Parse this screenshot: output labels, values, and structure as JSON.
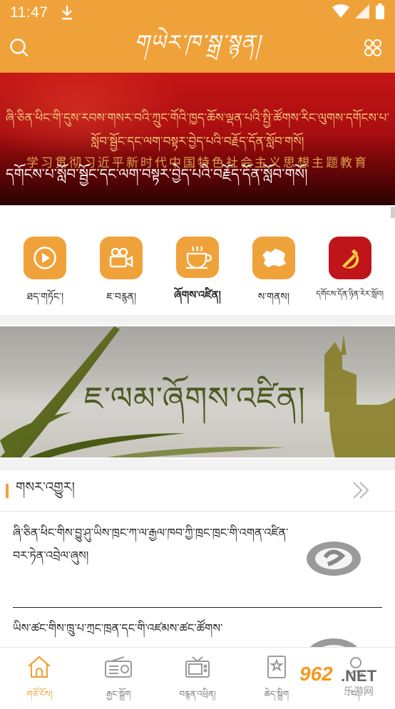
{
  "status_bar": {
    "time": "11:47"
  },
  "header": {
    "title": "གཡེར་ཁ་སྒྲ་སྙན།"
  },
  "banner": {
    "line1": "ཞི་ཅིན་ཕིང་གི་དུས་རབས་གསར་བའི་ཀྲུང་གོའི་ཁྱད་ཆོས་ལྡན་པའི་སྤྱི་ཚོགས་རིང་ལུགས་དགོངས་པ་",
    "line2": "སློབ་སྦྱོང་དང་ལག་བསྟར་བྱེད་པའི་བརྗོད་དོན་སློབ་གསོ།",
    "line3": "学习贯彻习近平新时代中国特色社会主义思想主题教育",
    "caption": "དགོངས་པ་སློབ་སྦྱོང་དང་ལག་བསྟར་བྱེད་པའི་བརྗོད་དོན་སློབ་གསོ།"
  },
  "categories": [
    {
      "label": "ཐད་གཏོང་།",
      "icon": "play-icon"
    },
    {
      "label": "ཇ་བརྙན།",
      "icon": "video-camera-icon"
    },
    {
      "label": "ཞོགས་འཛིན།",
      "icon": "tea-cup-icon"
    },
    {
      "label": "ས་གནས།",
      "icon": "map-icon"
    },
    {
      "label": "དགོངས་དོན་ཉིན་རེར་སློབ།",
      "icon": "party-emblem-icon"
    }
  ],
  "promo": {
    "title": "ཇ་ལམ་ཞོགས་འཛིན།"
  },
  "section": {
    "title": "གསར་འགྱུར།"
  },
  "news": [
    {
      "title": "ཞི་ཅིན་ཕིང་གིས་བྱུ་ཤུ་ཡིས་ཁྲང་ཀ་ལ་རྒྱལ་ཁབ་ཀྱི་ཁྲང་ཁྲང་གི་འགན་འཛིན་བར་ཏེན་འབྲེལ་ཞུས།"
    },
    {
      "title": "ཡིས་ཚང་གིས་ཁྲུ་པ་ཀྲང་ཁྲན་དང་གི་འཛམས་ཚང་ཚོགས་"
    }
  ],
  "tabs": [
    {
      "label": "གཙོ་ངོས།",
      "icon": "home-icon",
      "active": true
    },
    {
      "label": "རྒྱང་སྒྲོག",
      "icon": "radio-icon",
      "active": false
    },
    {
      "label": "བརྙན་འཕྲིན།",
      "icon": "tv-icon",
      "active": false
    },
    {
      "label": "ཆེད་སྒྲིག",
      "icon": "bookmark-icon",
      "active": false
    },
    {
      "label": "ང་།",
      "icon": "user-icon",
      "active": false
    }
  ],
  "watermark": {
    "number": "962",
    "domain": ".NET",
    "text": "乐游网"
  },
  "colors": {
    "accent": "#f0a23a",
    "banner_red": "#c41515",
    "party_red": "#c0141b"
  }
}
